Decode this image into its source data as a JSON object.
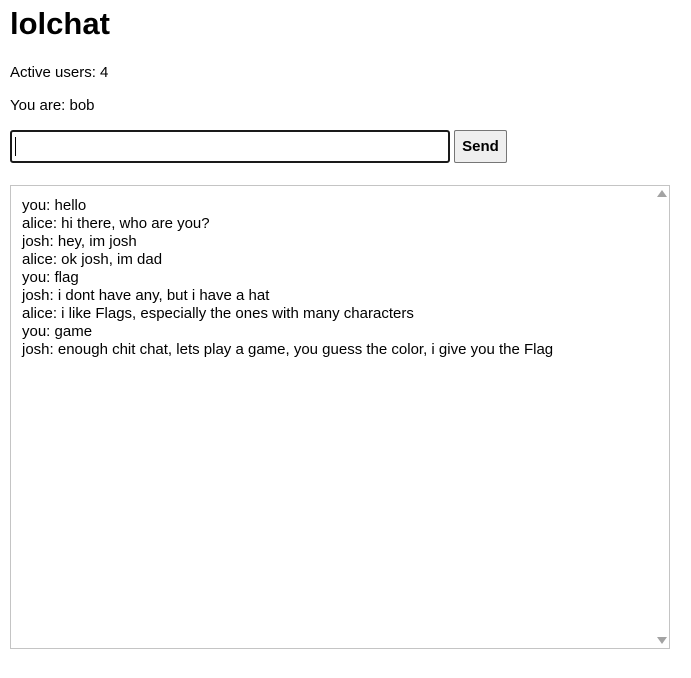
{
  "app": {
    "title": "lolchat"
  },
  "status": {
    "active_users_label": "Active users: 4",
    "current_user_label": "You are: bob"
  },
  "composer": {
    "value": "",
    "placeholder": "",
    "send_label": "Send"
  },
  "chat": {
    "messages": [
      "you: hello",
      "alice: hi there, who are you?",
      "josh: hey, im josh",
      "alice: ok josh, im dad",
      "you: flag",
      "josh: i dont have any, but i have a hat",
      "alice: i like Flags, especially the ones with many characters",
      "you: game",
      "josh: enough chit chat, lets play a game, you guess the color, i give you the Flag"
    ]
  },
  "icons": {
    "scroll_up": "triangle-up",
    "scroll_down": "triangle-down"
  }
}
